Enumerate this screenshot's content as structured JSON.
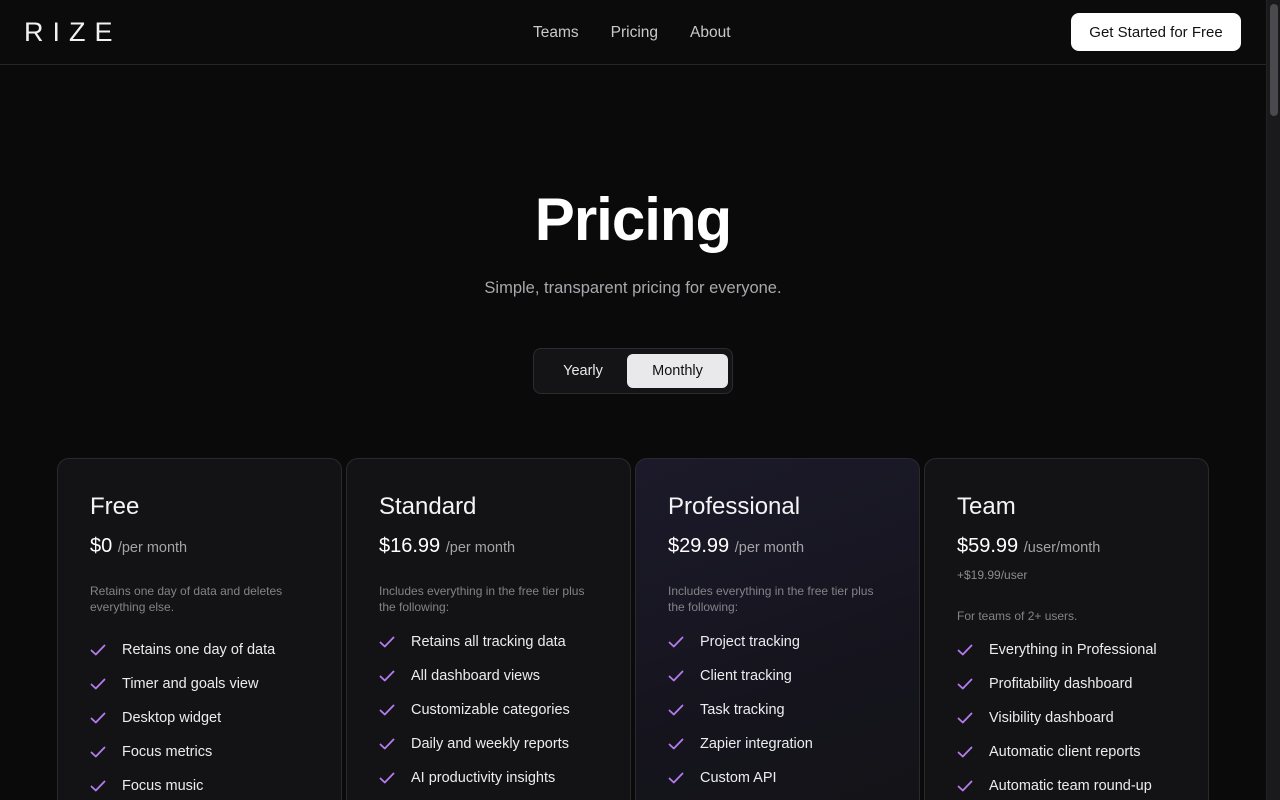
{
  "header": {
    "logo": "RIZE",
    "nav": [
      "Teams",
      "Pricing",
      "About"
    ],
    "cta": "Get Started for Free"
  },
  "hero": {
    "title": "Pricing",
    "subtitle": "Simple, transparent pricing for everyone."
  },
  "billing_toggle": {
    "options": [
      "Yearly",
      "Monthly"
    ],
    "selected": "Monthly"
  },
  "colors": {
    "check": "#b57cf0",
    "background": "#0a0a0b"
  },
  "plans": [
    {
      "name": "Free",
      "price": "$0",
      "period": "/per month",
      "extra": "",
      "description": "Retains one day of data and deletes everything else.",
      "features": [
        "Retains one day of data",
        "Timer and goals view",
        "Desktop widget",
        "Focus metrics",
        "Focus music"
      ]
    },
    {
      "name": "Standard",
      "price": "$16.99",
      "period": "/per month",
      "extra": "",
      "description": "Includes everything in the free tier plus the following:",
      "features": [
        "Retains all tracking data",
        "All dashboard views",
        "Customizable categories",
        "Daily and weekly reports",
        "AI productivity insights"
      ]
    },
    {
      "name": "Professional",
      "price": "$29.99",
      "period": "/per month",
      "extra": "",
      "description": "Includes everything in the free tier plus the following:",
      "features": [
        "Project tracking",
        "Client tracking",
        "Task tracking",
        "Zapier integration",
        "Custom API"
      ]
    },
    {
      "name": "Team",
      "price": "$59.99",
      "period": "/user/month",
      "extra": "+$19.99/user",
      "description": "For teams of 2+ users.",
      "features": [
        "Everything in Professional",
        "Profitability dashboard",
        "Visibility dashboard",
        "Automatic client reports",
        "Automatic team round-up"
      ]
    }
  ]
}
